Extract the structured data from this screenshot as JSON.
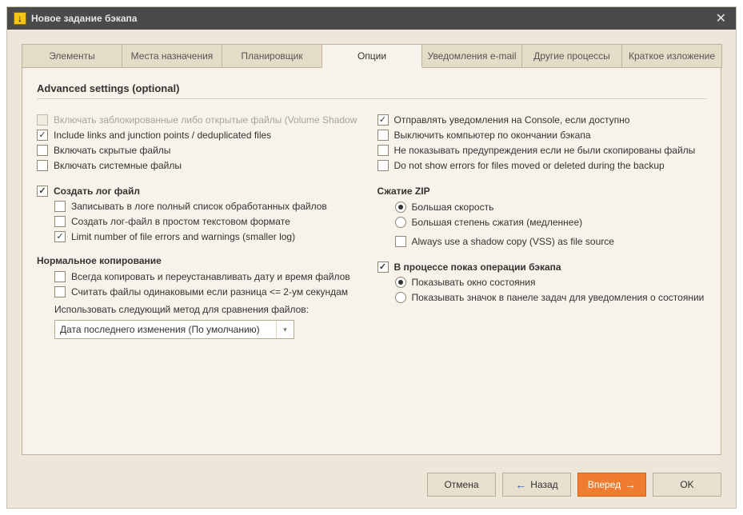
{
  "title": "Новое задание бэкапа",
  "tabs": [
    "Элементы",
    "Места назначения",
    "Планировщик",
    "Опции",
    "Уведомления e-mail",
    "Другие процессы",
    "Краткое изложение"
  ],
  "section_title": "Advanced settings (optional)",
  "left": {
    "opt_blocked": "Включать заблокированные либо открытые файлы (Volume Shadow",
    "opt_links": "Include links and junction points / deduplicated files",
    "opt_hidden": "Включать скрытые файлы",
    "opt_system": "Включать системные файлы",
    "log_head": "Создать лог файл",
    "log_full": "Записывать в логе полный список обработанных файлов",
    "log_plain": "Создать лог-файл в простом текстовом формате",
    "log_limit": "Limit number of file errors and warnings (smaller log)",
    "norm_head": "Нормальное копирование",
    "norm_date": "Всегда копировать и переустанавливать дату и время файлов",
    "norm_2sec": "Считать файлы одинаковыми если разница <= 2-ум секундам",
    "norm_method_label": "Использовать следующий метод для сравнения файлов:",
    "norm_method_value": "Дата последнего изменения (По умолчанию)"
  },
  "right": {
    "opt_console": "Отправлять уведомления на Console, если доступно",
    "opt_shutdown": "Выключить компьютер по окончании бэкапа",
    "opt_nowarn": "Не показывать предупреждения если не были скопированы файлы",
    "opt_noerrors": "Do not show errors for files moved or deleted during the backup",
    "zip_head": "Сжатие ZIP",
    "zip_fast": "Большая скорость",
    "zip_small": "Большая степень сжатия (медленнее)",
    "zip_vss": "Always use a shadow copy (VSS) as file source",
    "progress_head": "В процессе показ операции бэкапа",
    "progress_window": "Показывать окно состояния",
    "progress_tray": "Показывать значок в панеле задач для уведомления о состоянии опер"
  },
  "buttons": {
    "cancel": "Отмена",
    "back": "Назад",
    "next": "Вперед",
    "ok": "OK"
  }
}
